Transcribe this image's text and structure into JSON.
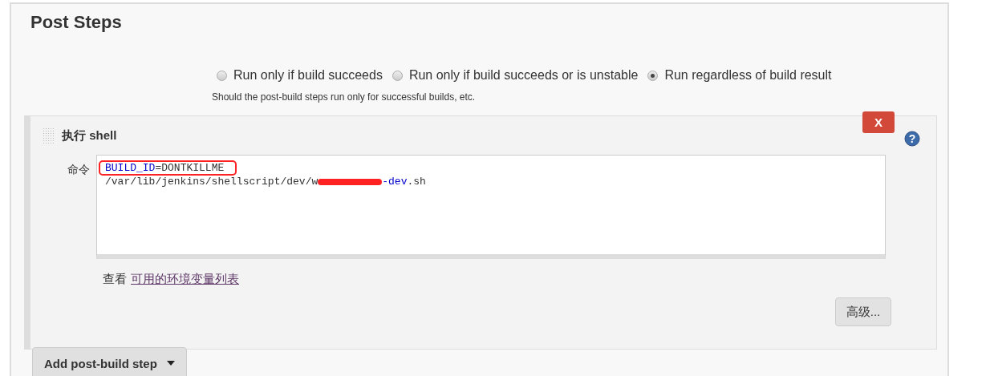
{
  "section": {
    "title": "Post Steps"
  },
  "run_condition": {
    "options": [
      {
        "label": "Run only if build succeeds",
        "selected": false
      },
      {
        "label": "Run only if build succeeds or is unstable",
        "selected": false
      },
      {
        "label": "Run regardless of build result",
        "selected": true
      }
    ],
    "help": "Should the post-build steps run only for successful builds, etc."
  },
  "step": {
    "title": "执行 shell",
    "delete_label": "X",
    "help_icon": "?",
    "field_label": "命令",
    "command_lines": [
      {
        "highlighted": true,
        "segments": [
          {
            "kind": "keyword",
            "text": "BUILD_ID"
          },
          {
            "kind": "plain",
            "text": "=DONTKILLME"
          }
        ]
      },
      {
        "highlighted": false,
        "segments": [
          {
            "kind": "plain",
            "text": "/var/lib/jenkins/shellscript/dev/w"
          },
          {
            "kind": "redaction"
          },
          {
            "kind": "keyword",
            "text": "-dev"
          },
          {
            "kind": "plain",
            "text": ".sh"
          }
        ]
      }
    ],
    "env_prefix": "查看",
    "env_link": "可用的环境变量列表",
    "advanced_button": "高级..."
  },
  "add_button": {
    "label": "Add post-build step"
  }
}
